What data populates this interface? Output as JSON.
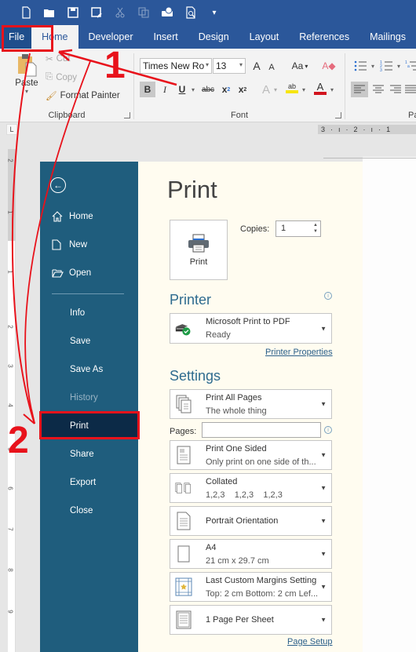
{
  "quick_access": {
    "icons": [
      "new-document-icon",
      "open-folder-icon",
      "save-icon",
      "save-as-icon",
      "cut-icon",
      "copy-icon",
      "touch-mode-icon",
      "print-preview-icon",
      "customize-icon"
    ]
  },
  "tabs": [
    {
      "label": "File"
    },
    {
      "label": "Home"
    },
    {
      "label": "Developer"
    },
    {
      "label": "Insert"
    },
    {
      "label": "Design"
    },
    {
      "label": "Layout"
    },
    {
      "label": "References"
    },
    {
      "label": "Mailings"
    }
  ],
  "ribbon": {
    "clipboard": {
      "label": "Clipboard",
      "paste": "Paste",
      "cut": "Cut",
      "copy": "Copy",
      "format_painter": "Format Painter"
    },
    "font": {
      "label": "Font",
      "font_name": "Times New Ro",
      "font_size": "13",
      "grow": "A",
      "shrink": "A",
      "change_case": "Aa",
      "bold": "B",
      "italic": "I",
      "underline": "U",
      "strikethrough": "abc",
      "subscript": "x",
      "superscript": "x",
      "text_effects": "A",
      "highlight": "ab",
      "font_color": "A",
      "highlight_color": "#f7e511",
      "font_color_value": "#d1141e"
    },
    "paragraph": {
      "label": "Pa"
    }
  },
  "ruler": {
    "horizontal": [
      "3",
      "·",
      "ı",
      "·",
      "2",
      "·",
      "ı",
      "·",
      "1"
    ],
    "vertical_numbers": [
      "2",
      "1",
      "1",
      "2",
      "3",
      "4",
      "5",
      "6",
      "7",
      "8",
      "9"
    ]
  },
  "backstage": {
    "nav": [
      {
        "label": "Home",
        "icon": "home-icon"
      },
      {
        "label": "New",
        "icon": "new-document-icon"
      },
      {
        "label": "Open",
        "icon": "open-folder-icon"
      },
      {
        "label": "Info"
      },
      {
        "label": "Save"
      },
      {
        "label": "Save As"
      },
      {
        "label": "History",
        "disabled": true
      },
      {
        "label": "Print",
        "selected": true
      },
      {
        "label": "Share"
      },
      {
        "label": "Export"
      },
      {
        "label": "Close"
      }
    ]
  },
  "print": {
    "title": "Print",
    "print_button": "Print",
    "copies_label": "Copies:",
    "copies_value": "1",
    "printer_section": "Printer",
    "printer_name": "Microsoft Print to PDF",
    "printer_status": "Ready",
    "printer_properties": "Printer Properties",
    "settings_section": "Settings",
    "pages_label": "Pages:",
    "pages_value": "",
    "settings": [
      {
        "line1": "Print All Pages",
        "line2": "The whole thing",
        "icon": "pages-stack-icon"
      },
      {
        "line1": "Print One Sided",
        "line2": "Only print on one side of th...",
        "icon": "one-sided-icon"
      },
      {
        "line1": "Collated",
        "line2": "1,2,3    1,2,3    1,2,3",
        "icon": "collated-icon"
      },
      {
        "line1": "Portrait Orientation",
        "line2": "",
        "icon": "portrait-icon"
      },
      {
        "line1": "A4",
        "line2": "21 cm x 29.7 cm",
        "icon": "paper-size-icon"
      },
      {
        "line1": "Last Custom Margins Setting",
        "line2": "Top: 2 cm Bottom: 2 cm Lef...",
        "icon": "margins-icon"
      },
      {
        "line1": "1 Page Per Sheet",
        "line2": "",
        "icon": "pages-per-sheet-icon"
      }
    ],
    "page_setup": "Page Setup"
  },
  "annotations": {
    "step1": "1",
    "step2": "2",
    "color": "#e8121b"
  }
}
